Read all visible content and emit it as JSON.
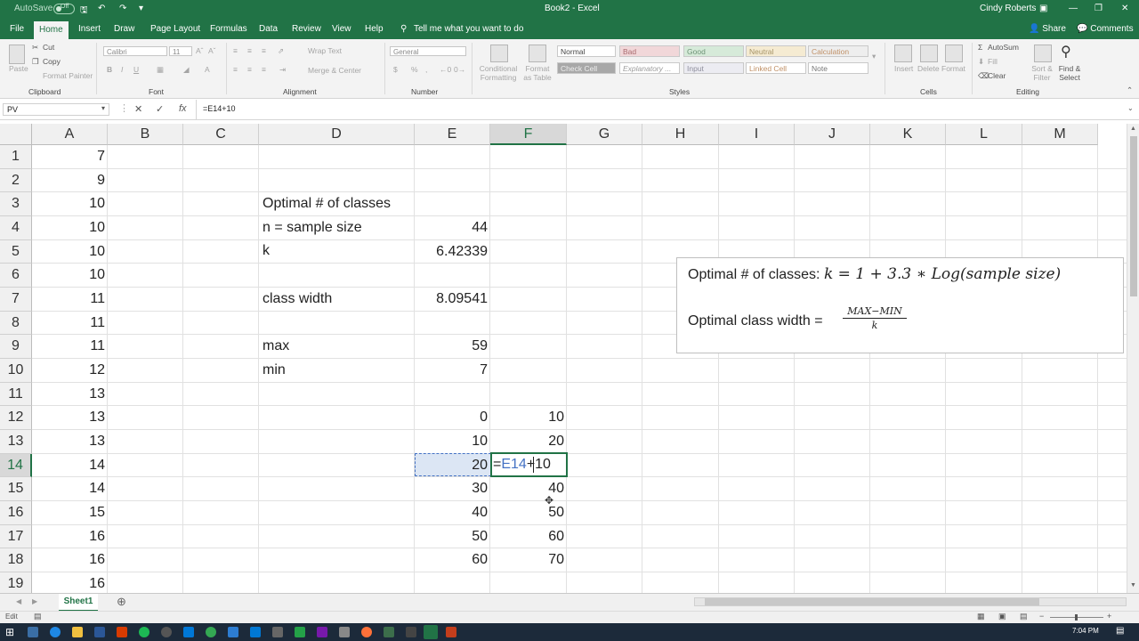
{
  "titlebar": {
    "autosave_label": "AutoSave",
    "autosave_state": "Off",
    "doc_title": "Book2  -  Excel",
    "user_name": "Cindy Roberts",
    "bg": "#217346"
  },
  "tabs": [
    "File",
    "Home",
    "Draw",
    "Page Layout",
    "Formulas",
    "Data",
    "Review",
    "View",
    "Help"
  ],
  "tell_me": "Tell me what you want to do",
  "share_label": "Share",
  "comments_label": "Comments",
  "ribbon": {
    "clipboard": {
      "paste": "Paste",
      "cut": "Cut",
      "copy": "Copy",
      "format_painter": "Format Painter",
      "group": "Clipboard"
    },
    "font": {
      "name": "Calibri",
      "size": "11",
      "group": "Font"
    },
    "alignment": {
      "wrap_text": "Wrap Text",
      "merge_center": "Merge & Center",
      "group": "Alignment"
    },
    "number": {
      "format": "General",
      "group": "Number"
    },
    "styles": {
      "conditional": "Conditional Formatting",
      "format_as_table": "Format as Table",
      "cells": [
        "Normal",
        "Bad",
        "Good",
        "Neutral",
        "Calculation",
        "Check Cell",
        "Explanatory ...",
        "Input",
        "Linked Cell",
        "Note"
      ],
      "group": "Styles"
    },
    "cells": {
      "insert": "Insert",
      "delete": "Delete",
      "format": "Format",
      "group": "Cells"
    },
    "editing": {
      "autosum": "AutoSum",
      "fill": "Fill",
      "clear": "Clear",
      "sort_filter": "Sort & Filter",
      "find_select": "Find & Select",
      "group": "Editing"
    }
  },
  "formula_bar": {
    "name_box": "PV",
    "formula": "=E14+10"
  },
  "columns": [
    "A",
    "B",
    "C",
    "D",
    "E",
    "F",
    "G",
    "H",
    "I",
    "J",
    "K",
    "L",
    "M"
  ],
  "rows": [
    "1",
    "2",
    "3",
    "4",
    "5",
    "6",
    "7",
    "8",
    "9",
    "10",
    "11",
    "12",
    "13",
    "14",
    "15",
    "16",
    "17",
    "18",
    "19"
  ],
  "col_a_values": [
    "7",
    "9",
    "10",
    "10",
    "10",
    "10",
    "11",
    "11",
    "11",
    "12",
    "13",
    "13",
    "13",
    "14",
    "14",
    "15",
    "16",
    "16",
    "16"
  ],
  "col_d_labels": {
    "r3": "Optimal # of classes",
    "r4": "n = sample size",
    "r5": "k",
    "r7": "class width",
    "r9": "max",
    "r10": "min"
  },
  "col_e_values": {
    "r4": "44",
    "r5": "6.42339",
    "r7": "8.09541",
    "r9": "59",
    "r10": "7",
    "r12": "0",
    "r13": "10",
    "r14": "20",
    "r15": "30",
    "r16": "40",
    "r17": "50",
    "r18": "60"
  },
  "col_f_values": {
    "r12": "10",
    "r13": "20",
    "r15": "40",
    "r16": "50",
    "r17": "60",
    "r18": "70"
  },
  "edit_cell": {
    "eq": "=",
    "ref": "E14",
    "rest": "+10"
  },
  "note_box": {
    "line1_prefix": "Optimal # of classes: ",
    "line1_formula": "k =  1 + 3.3  ∗ Log(sample size)",
    "line2_prefix": "Optimal class width = ",
    "line2_numerator": "MAX−MIN",
    "line2_denominator": "k"
  },
  "sheet_tab": "Sheet1",
  "status": {
    "mode": "Edit",
    "time": "7:04 PM"
  },
  "colors": {
    "excel_green": "#217346",
    "selection": "#dce6f4",
    "ref_blue": "#4472c4"
  }
}
